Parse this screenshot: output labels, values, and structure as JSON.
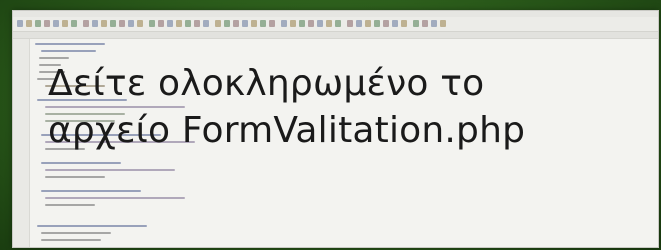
{
  "slide": {
    "caption_line1": "Δείτε ολοκληρωμένο το",
    "caption_line2": "αρχείο FormValitation.php"
  },
  "colors": {
    "slide_background": "#2a5a1a",
    "editor_background": "#f3f3f0",
    "caption_text": "#1a1a1a"
  }
}
